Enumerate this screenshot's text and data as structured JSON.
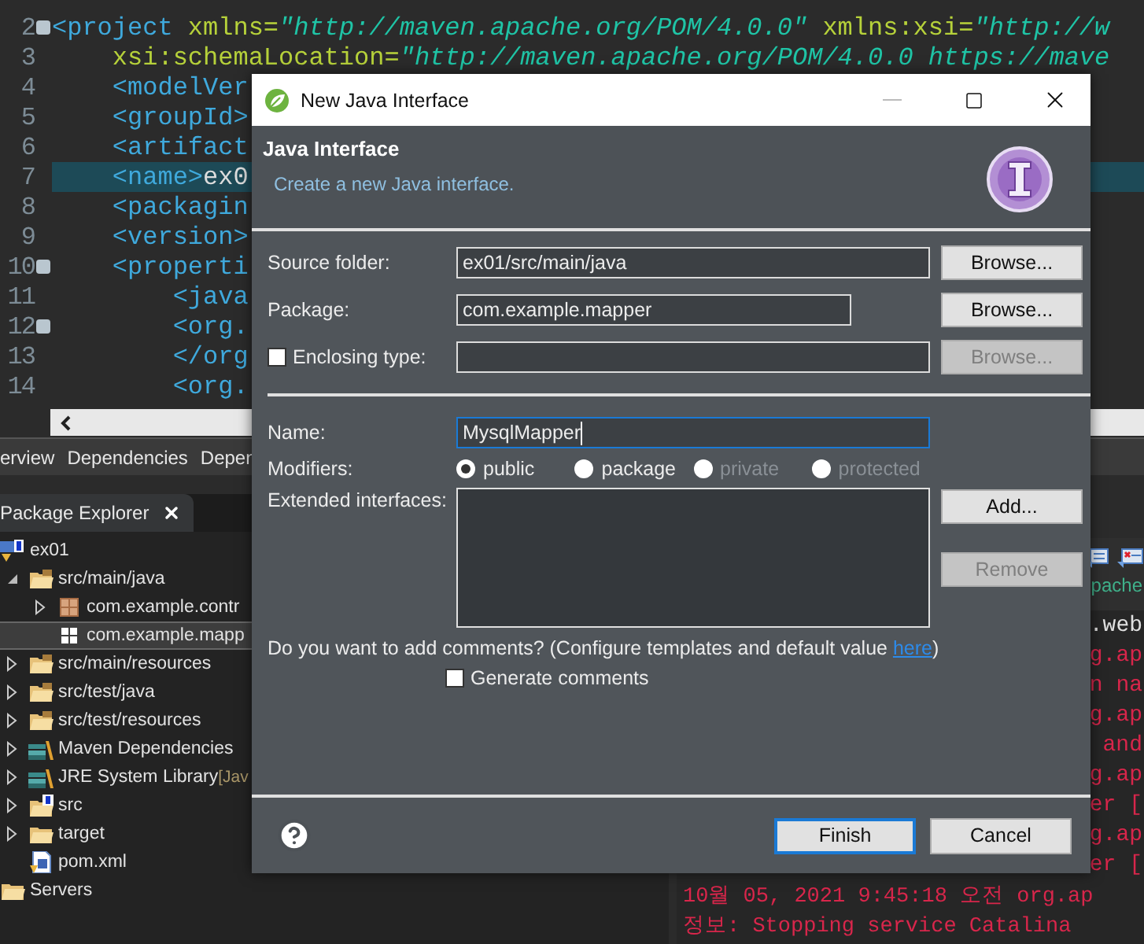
{
  "editor": {
    "lines": [
      {
        "number": "2",
        "fold": true,
        "highlighted": false,
        "tokens": [
          {
            "kind": "tag",
            "text": "<project"
          },
          {
            "kind": "attr",
            "text": " xmlns="
          },
          {
            "kind": "value",
            "text": "\"http://maven.apache.org/POM/4.0.0\""
          },
          {
            "kind": "attr",
            "text": " xmlns:xsi="
          },
          {
            "kind": "value",
            "text": "\"http://w"
          }
        ]
      },
      {
        "number": "3",
        "fold": false,
        "highlighted": false,
        "tokens": [
          {
            "kind": "attr",
            "text": "    xsi:schemaLocation="
          },
          {
            "kind": "value",
            "text": "\"http://maven.apache.org/POM/4.0.0 https://mave"
          }
        ]
      },
      {
        "number": "4",
        "fold": false,
        "highlighted": false,
        "tokens": [
          {
            "kind": "tag",
            "text": "    <modelVer"
          }
        ]
      },
      {
        "number": "5",
        "fold": false,
        "highlighted": false,
        "tokens": [
          {
            "kind": "tag",
            "text": "    <groupId>"
          }
        ]
      },
      {
        "number": "6",
        "fold": false,
        "highlighted": false,
        "tokens": [
          {
            "kind": "tag",
            "text": "    <artifact"
          }
        ]
      },
      {
        "number": "7",
        "fold": false,
        "highlighted": true,
        "tokens": [
          {
            "kind": "tag",
            "text": "    <name>"
          },
          {
            "kind": "plain",
            "text": "ex0"
          }
        ]
      },
      {
        "number": "8",
        "fold": false,
        "highlighted": false,
        "tokens": [
          {
            "kind": "tag",
            "text": "    <packagin"
          }
        ]
      },
      {
        "number": "9",
        "fold": false,
        "highlighted": false,
        "tokens": [
          {
            "kind": "tag",
            "text": "    <version>"
          }
        ]
      },
      {
        "number": "10",
        "fold": true,
        "highlighted": false,
        "tokens": [
          {
            "kind": "tag",
            "text": "    <properti"
          }
        ]
      },
      {
        "number": "11",
        "fold": false,
        "highlighted": false,
        "tokens": [
          {
            "kind": "tag",
            "text": "        <java"
          }
        ]
      },
      {
        "number": "12",
        "fold": true,
        "highlighted": false,
        "tokens": [
          {
            "kind": "tag",
            "text": "        <org."
          }
        ]
      },
      {
        "number": "13",
        "fold": false,
        "highlighted": false,
        "tokens": [
          {
            "kind": "tag",
            "text": "        </org"
          }
        ]
      },
      {
        "number": "14",
        "fold": false,
        "highlighted": false,
        "tokens": [
          {
            "kind": "tag",
            "text": "        <org."
          }
        ]
      }
    ]
  },
  "editor_tabs": [
    {
      "label": "erview"
    },
    {
      "label": "Dependencies"
    },
    {
      "label": "Depen"
    }
  ],
  "package_explorer": {
    "title": "Package Explorer",
    "tree": [
      {
        "label": "ex01",
        "kind": "project",
        "selected": false,
        "children": [
          {
            "label": "src/main/java",
            "kind": "source",
            "expanded": true,
            "selected": false,
            "children": [
              {
                "label": "com.example.contr",
                "kind": "package",
                "expanded": false,
                "selected": false
              },
              {
                "label": "com.example.mapp",
                "kind": "empty",
                "selected": true
              }
            ]
          },
          {
            "label": "src/main/resources",
            "kind": "source",
            "expanded": false,
            "selected": false
          },
          {
            "label": "src/test/java",
            "kind": "source",
            "expanded": false,
            "selected": false
          },
          {
            "label": "src/test/resources",
            "kind": "source",
            "expanded": false,
            "selected": false
          },
          {
            "label": "Maven Dependencies",
            "kind": "library",
            "expanded": false,
            "selected": false
          },
          {
            "label": "JRE System Library",
            "decoration": "[Jav",
            "kind": "library",
            "expanded": false,
            "selected": false
          },
          {
            "label": "src",
            "kind": "marked",
            "expanded": false,
            "selected": false
          },
          {
            "label": "target",
            "kind": "folder",
            "expanded": false,
            "selected": false
          },
          {
            "label": "pom.xml",
            "kind": "xml",
            "selected": false
          }
        ]
      },
      {
        "label": "Servers",
        "kind": "folder",
        "selected": false
      }
    ]
  },
  "console": {
    "label": "pache",
    "tails": [
      {
        "text": ".web",
        "color": "#e0e0e0"
      },
      {
        "text": "g.ap",
        "color": "#d8264b"
      },
      {
        "text": "n na",
        "color": "#d8264b"
      },
      {
        "text": "g.ap",
        "color": "#d8264b"
      },
      {
        "text": "and",
        "color": "#d8264b"
      },
      {
        "text": "g.ap",
        "color": "#d8264b"
      },
      {
        "text": "er [",
        "color": "#d8264b"
      },
      {
        "text": "g.ap",
        "color": "#d8264b"
      },
      {
        "text": "er [",
        "color": "#d8264b"
      }
    ],
    "lines": [
      {
        "text": "10월 05, 2021 9:45:18 오전 org.ap",
        "color": "#d8264b"
      },
      {
        "text": "정보: Stopping service Catalina",
        "color": "#d8264b"
      }
    ]
  },
  "dialog": {
    "title": "New Java Interface",
    "heading": "Java Interface",
    "description": "Create a new Java interface.",
    "fields": [
      {
        "kind": "text",
        "label": "Source folder:",
        "value": "ex01/src/main/java",
        "button": {
          "label": "Browse...",
          "disabled": false
        }
      },
      {
        "kind": "short",
        "label": "Package:",
        "value": "com.example.mapper",
        "button": {
          "label": "Browse...",
          "disabled": false
        }
      },
      {
        "kind": "checkbox",
        "label": "Enclosing type:",
        "checked": false,
        "button": {
          "label": "Browse...",
          "disabled": true
        }
      }
    ],
    "name": {
      "label": "Name:",
      "value": "MysqlMapper",
      "focused": true
    },
    "modifiers": {
      "label": "Modifiers:",
      "options": [
        {
          "label": "public",
          "selected": true,
          "disabled": false
        },
        {
          "label": "package",
          "selected": false,
          "disabled": false
        },
        {
          "label": "private",
          "selected": false,
          "disabled": true
        },
        {
          "label": "protected",
          "selected": false,
          "disabled": true
        }
      ]
    },
    "extended": {
      "label": "Extended interfaces:",
      "buttons": [
        {
          "label": "Add...",
          "disabled": false
        },
        {
          "label": "Remove",
          "disabled": true
        }
      ]
    },
    "comments": {
      "text": "Do you want to add comments? (Configure templates and default value ",
      "link": "here",
      "tail": ")"
    },
    "generate_comments": {
      "label": "Generate comments",
      "checked": false
    },
    "buttons": [
      {
        "label": "Finish",
        "default": true
      },
      {
        "label": "Cancel",
        "default": false
      }
    ]
  }
}
